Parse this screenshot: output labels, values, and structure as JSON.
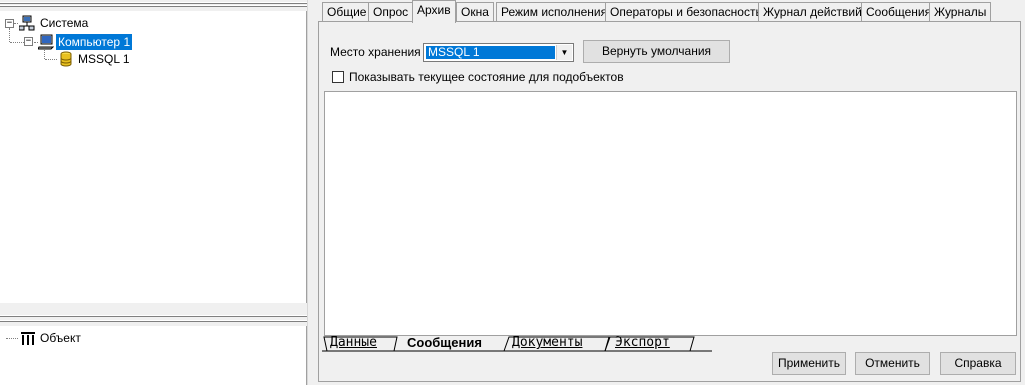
{
  "tree": {
    "items": [
      {
        "label": "Система",
        "icon": "network-icon"
      },
      {
        "label": "Компьютер 1",
        "icon": "computer-icon",
        "selected": true
      },
      {
        "label": "MSSQL 1",
        "icon": "database-icon"
      }
    ]
  },
  "object_tree": {
    "items": [
      {
        "label": "Объект",
        "icon": "object-icon"
      }
    ]
  },
  "tabs": [
    "Общие",
    "Опрос",
    "Архив",
    "Окна",
    "Режим исполнения",
    "Операторы и безопасность",
    "Журнал действий",
    "Сообщения",
    "Журналы"
  ],
  "active_tab": "Архив",
  "archive": {
    "storage_label": "Место хранения",
    "storage_value": "MSSQL 1",
    "reset_button": "Вернуть умолчания",
    "show_state_checkbox": "Показывать текущее состояние для подобъектов",
    "show_state_checked": false
  },
  "bottom_tabs": [
    "Данные",
    "Сообщения",
    "Документы",
    "Экспорт"
  ],
  "active_bottom_tab": "Сообщения",
  "buttons": {
    "apply": "Применить",
    "cancel": "Отменить",
    "help": "Справка"
  },
  "colors": {
    "selection": "#0078d7",
    "panel": "#f0f0f0"
  }
}
